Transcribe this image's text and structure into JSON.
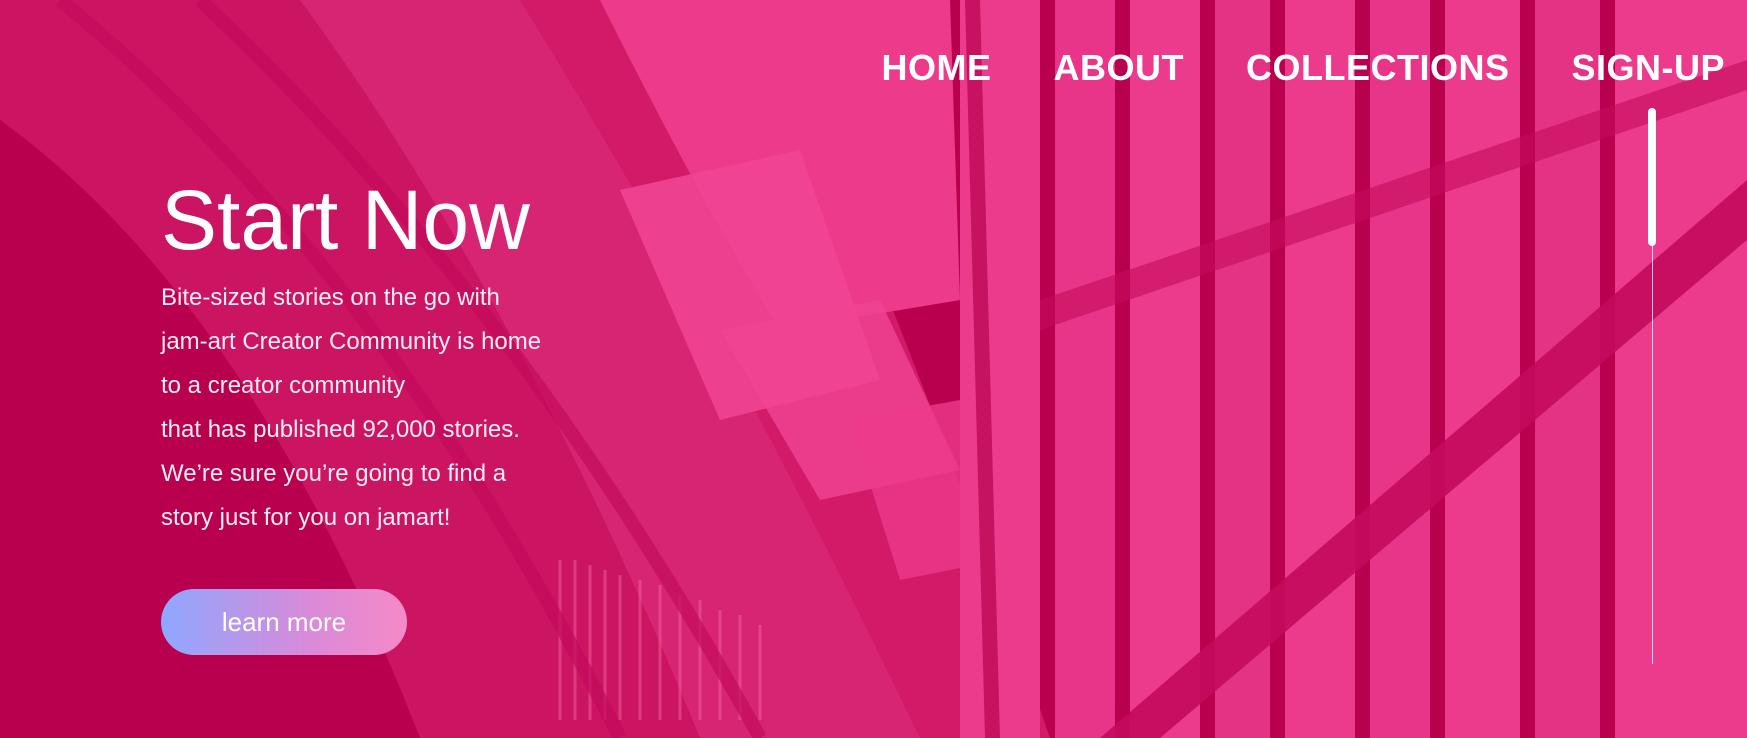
{
  "nav": {
    "items": [
      {
        "label": "HOME"
      },
      {
        "label": "ABOUT"
      },
      {
        "label": "COLLECTIONS"
      },
      {
        "label": "SIGN-UP"
      }
    ]
  },
  "hero": {
    "title": "Start Now",
    "description_lines": [
      "Bite-sized stories on the go with",
      "jam-art Creator Community is home",
      "to a creator community",
      "that has published 92,000 stories.",
      "We’re sure you’re going to find a",
      "story just for you on jamart!"
    ],
    "cta_label": "learn more"
  },
  "colors": {
    "background": "#b8004f",
    "overlay": "#ec3b8d",
    "text": "#ffffff",
    "button_gradient_start": "#8fa7ff",
    "button_gradient_end": "#f58ac8"
  },
  "background_image": {
    "icon": "library-bookshelves-image"
  }
}
